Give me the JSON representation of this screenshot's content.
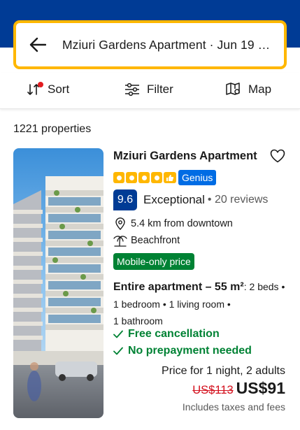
{
  "search": {
    "text": "Mziuri Gardens Apartment · Jun 19 - J..."
  },
  "toolbar": {
    "sort_label": "Sort",
    "filter_label": "Filter",
    "map_label": "Map"
  },
  "results": {
    "count_text": "1221 properties"
  },
  "property": {
    "name": "Mziuri Gardens Apartment",
    "star_rating": 4,
    "genius_label": "Genius",
    "score": "9.6",
    "score_word": "Exceptional",
    "reviews": "• 20 reviews",
    "distance": "5.4 km from downtown",
    "beach": "Beachfront",
    "badge": "Mobile-only price",
    "room_type": "Entire apartment – 55 m²",
    "room_beds": ": 2 beds •",
    "room_line2": "1 bedroom • 1 living room •",
    "room_line3": "1 bathroom",
    "perk_1": "Free cancellation",
    "perk_2": "No prepayment needed",
    "price_label": "Price for 1 night, 2 adults",
    "old_price": "US$113",
    "new_price": "US$91",
    "taxes": "Includes taxes and fees"
  },
  "colors": {
    "brand_blue": "#003b95",
    "search_border": "#ffb700",
    "genius_blue": "#006ce4",
    "green": "#008234",
    "red": "#d4111e"
  }
}
